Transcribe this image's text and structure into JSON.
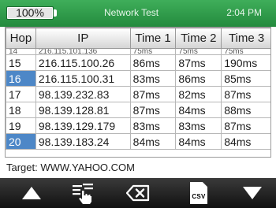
{
  "status": {
    "battery": "100%",
    "battery_level": 1.0,
    "title": "Network Test",
    "time": "2:04 PM"
  },
  "table": {
    "headers": [
      "Hop",
      "IP",
      "Time 1",
      "Time 2",
      "Time 3"
    ],
    "partial_row": [
      "14",
      "216.115.101.136",
      "75ms",
      "75ms",
      "75ms"
    ],
    "rows": [
      {
        "hop": "15",
        "ip": "216.115.100.26",
        "t1": "86ms",
        "t2": "87ms",
        "t3": "190ms",
        "selected": false
      },
      {
        "hop": "16",
        "ip": "216.115.100.31",
        "t1": "83ms",
        "t2": "86ms",
        "t3": "85ms",
        "selected": true
      },
      {
        "hop": "17",
        "ip": "98.139.232.83",
        "t1": "87ms",
        "t2": "82ms",
        "t3": "87ms",
        "selected": false
      },
      {
        "hop": "18",
        "ip": "98.139.128.81",
        "t1": "87ms",
        "t2": "84ms",
        "t3": "88ms",
        "selected": false
      },
      {
        "hop": "19",
        "ip": "98.139.129.179",
        "t1": "83ms",
        "t2": "83ms",
        "t3": "87ms",
        "selected": false
      },
      {
        "hop": "20",
        "ip": "98.139.183.24",
        "t1": "84ms",
        "t2": "84ms",
        "t3": "84ms",
        "selected": true
      }
    ]
  },
  "target": "Target: WWW.YAHOO.COM",
  "toolbar": {
    "up_icon": "arrow-up-icon",
    "pointer_icon": "tap-hand-icon",
    "backspace_icon": "backspace-icon",
    "csv_label": "CSV",
    "down_icon": "arrow-down-icon"
  }
}
